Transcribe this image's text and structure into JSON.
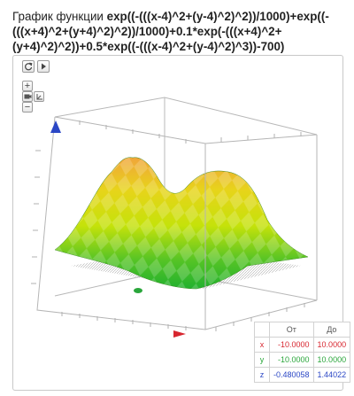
{
  "title": {
    "prefix": "График функции ",
    "function": "exp((-(((x-4)^2+(y-4)^2)^2))/1000)+exp((-(((x+4)^2+(y+4)^2)^2))/1000)+0.1*exp(-(((x+4)^2+(y+4)^2)^2))+0.5*exp((-(((x-4)^2+(y-4)^2)^3))-700)"
  },
  "toolbar": {
    "refresh_icon": "refresh-icon",
    "play_icon": "play-icon",
    "zoom_in_label": "+",
    "zoom_out_label": "−"
  },
  "colors": {
    "surface_top": "#f0a53a",
    "surface_mid": "#e7ef00",
    "surface_low": "#22b12e",
    "x_axis": "#d7262f",
    "y_axis": "#2aa63b",
    "z_axis": "#2b47c5"
  },
  "range_table": {
    "headers": [
      "",
      "От",
      "До"
    ],
    "rows": [
      {
        "axis": "x",
        "from": "-10.0000",
        "to": "10.0000",
        "color": "#d7262f"
      },
      {
        "axis": "y",
        "from": "-10.0000",
        "to": "10.0000",
        "color": "#2aa63b"
      },
      {
        "axis": "z",
        "from": "-0.480058",
        "to": "1.44022",
        "color": "#2b47c5"
      }
    ]
  }
}
